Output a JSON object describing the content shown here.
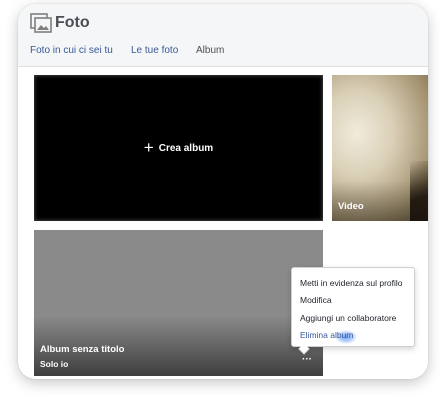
{
  "header": {
    "title": "Foto",
    "logo_icon": "photo-gallery-icon"
  },
  "tabs": [
    {
      "label": "Foto in cui ci sei tu",
      "active": false
    },
    {
      "label": "Le tue foto",
      "active": false
    },
    {
      "label": "Album",
      "active": true
    }
  ],
  "albums": {
    "create": {
      "label": "Crea album",
      "icon": "plus-icon"
    },
    "video": {
      "label": "Video"
    },
    "untitled": {
      "title": "Album senza titolo",
      "privacy": "Solo io",
      "more_icon": "more-options-icon"
    }
  },
  "context_menu": {
    "items": [
      {
        "label": "Metti in evidenza sul profilo"
      },
      {
        "label": "Modifica"
      },
      {
        "label": "Aggiungi un collaboratore"
      },
      {
        "label": "Elimina album",
        "highlighted": true
      }
    ]
  },
  "colors": {
    "link_blue": "#385898",
    "header_bg": "#f5f6f7",
    "highlight": "#4285f4"
  }
}
